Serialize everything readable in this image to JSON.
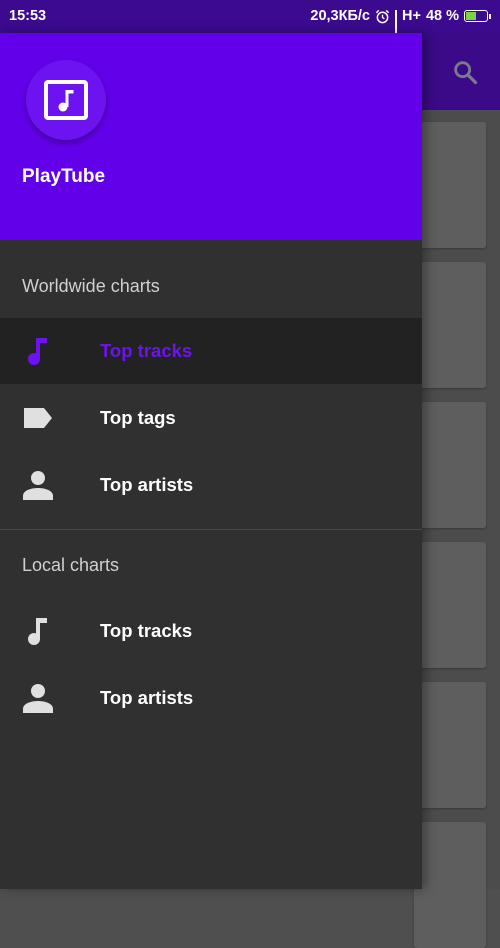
{
  "status_bar": {
    "time": "15:53",
    "speed": "20,3КБ/с",
    "network": "H+",
    "battery_percent": "48 %",
    "icons": [
      "alarm-icon",
      "signal-icon",
      "battery-charging-icon"
    ]
  },
  "app": {
    "toolbar_icon": "search-icon",
    "brand_color": "#6200ea"
  },
  "drawer": {
    "app_name": "PlayTube",
    "logo_icon": "music-note-icon",
    "sections": [
      {
        "title": "Worldwide charts",
        "items": [
          {
            "label": "Top tracks",
            "icon": "music-note-icon",
            "selected": true
          },
          {
            "label": "Top tags",
            "icon": "tag-icon",
            "selected": false
          },
          {
            "label": "Top artists",
            "icon": "person-icon",
            "selected": false
          }
        ]
      },
      {
        "title": "Local charts",
        "items": [
          {
            "label": "Top tracks",
            "icon": "music-note-icon",
            "selected": false
          },
          {
            "label": "Top artists",
            "icon": "person-icon",
            "selected": false
          }
        ]
      }
    ]
  }
}
